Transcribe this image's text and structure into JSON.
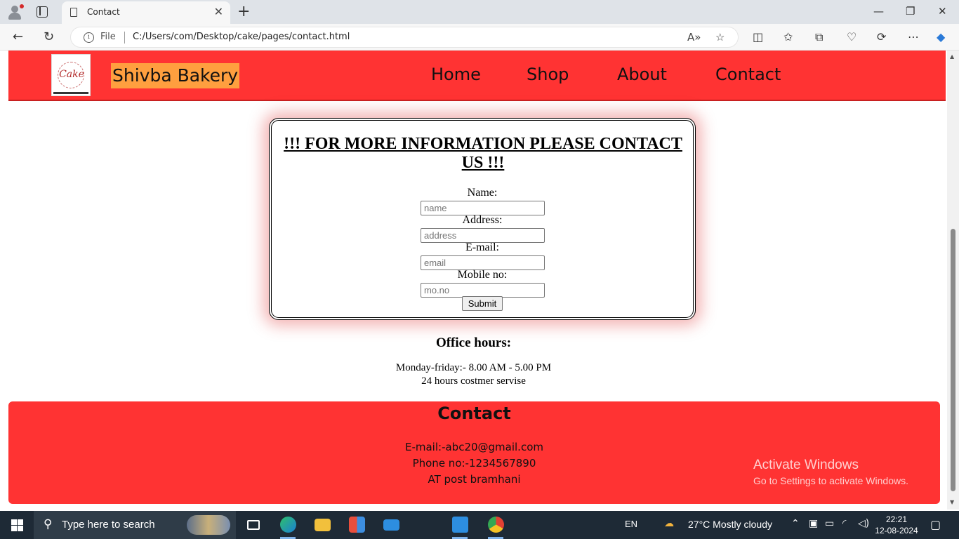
{
  "browser": {
    "tab_title": "Contact",
    "address_prefix": "File",
    "url": "C:/Users/com/Desktop/cake/pages/contact.html"
  },
  "header": {
    "brand": "Shivba Bakery",
    "logo_word": "Cake",
    "nav": [
      "Home",
      "Shop",
      "About",
      "Contact"
    ]
  },
  "form": {
    "heading": "!!! FOR MORE INFORMATION PLEASE CONTACT US !!!",
    "fields": [
      {
        "label": "Name:",
        "placeholder": "name"
      },
      {
        "label": "Address:",
        "placeholder": "address"
      },
      {
        "label": "E-mail:",
        "placeholder": "email"
      },
      {
        "label": "Mobile no:",
        "placeholder": "mo.no"
      }
    ],
    "submit_label": "Submit"
  },
  "office": {
    "title": "Office hours:",
    "hours": "Monday-friday:- 8.00 AM - 5.00 PM",
    "service": "24 hours costmer servise"
  },
  "footer": {
    "title": "Contact",
    "email": "E-mail:-abc20@gmail.com",
    "phone": "Phone no:-1234567890",
    "address": "AT post bramhani"
  },
  "watermark": {
    "line1": "Activate Windows",
    "line2": "Go to Settings to activate Windows."
  },
  "taskbar": {
    "search_placeholder": "Type here to search",
    "language": "EN",
    "weather": "27°C  Mostly cloudy",
    "time": "22:21",
    "date": "12-08-2024"
  },
  "colors": {
    "header_red": "#ff3333",
    "brand_highlight": "#ff9f3f",
    "taskbar": "#1e2a36"
  }
}
